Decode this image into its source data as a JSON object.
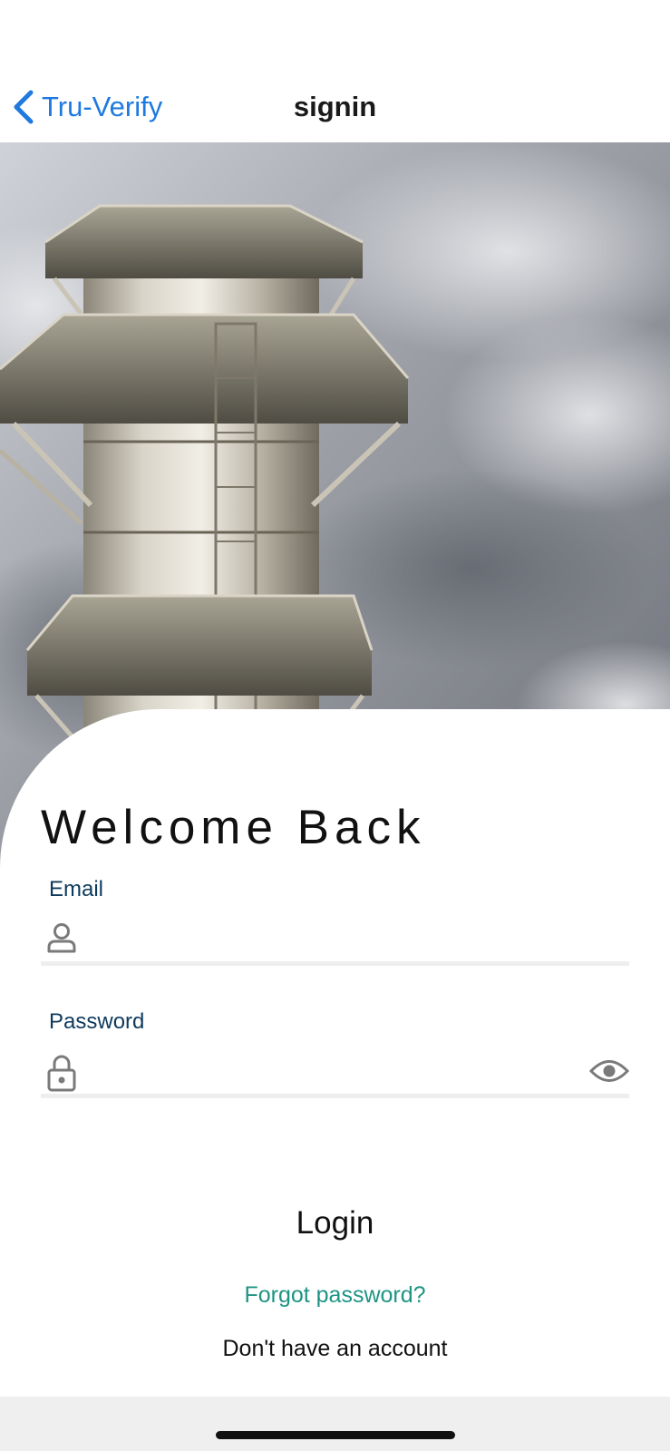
{
  "nav": {
    "back_label": "Tru-Verify",
    "title": "signin"
  },
  "form": {
    "heading": "Welcome Back",
    "email_label": "Email",
    "email_value": "",
    "password_label": "Password",
    "password_value": "",
    "login_label": "Login",
    "forgot_label": "Forgot password?",
    "signup_label": "Don't have an account"
  },
  "colors": {
    "accent_blue": "#1f7ae0",
    "link_teal": "#1e9484",
    "label_navy": "#0e3a5c"
  },
  "icons": {
    "back": "chevron-left-icon",
    "email": "user-icon",
    "password": "lock-icon",
    "toggle": "eye-icon"
  }
}
